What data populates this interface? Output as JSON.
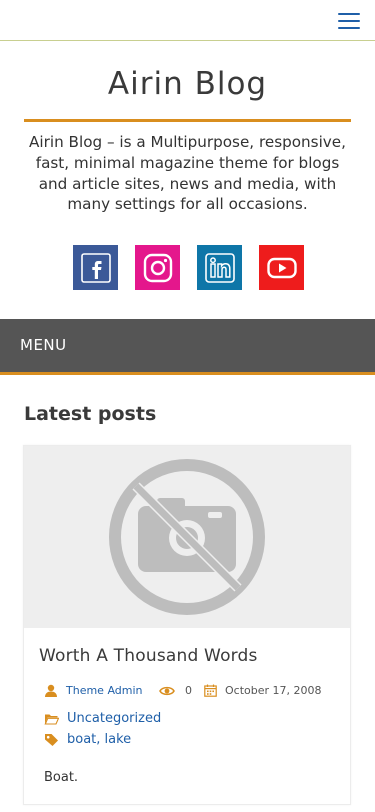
{
  "header": {
    "menu_icon": "hamburger-icon"
  },
  "site": {
    "title": "Airin Blog",
    "tagline": "Airin Blog – is a Multipurpose, responsive, fast, minimal magazine theme for blogs and article sites, news and media, with many settings for all occasions."
  },
  "social": [
    {
      "name": "facebook",
      "icon": "facebook-icon",
      "color": "#3b5998"
    },
    {
      "name": "instagram",
      "icon": "instagram-icon",
      "color": "#e4178c"
    },
    {
      "name": "linkedin",
      "icon": "linkedin-icon",
      "color": "#0e76a8"
    },
    {
      "name": "youtube",
      "icon": "youtube-icon",
      "color": "#ee1c1c"
    }
  ],
  "nav": {
    "menu_label": "MENU"
  },
  "main": {
    "section_title": "Latest posts",
    "posts": [
      {
        "title": "Worth A Thousand Words",
        "author": "Theme Admin",
        "views": "0",
        "date": "October 17, 2008",
        "category": "Uncategorized",
        "tags": "boat, lake",
        "excerpt": "Boat."
      }
    ]
  },
  "colors": {
    "accent": "#d98e1f",
    "link": "#1f5fa8",
    "menubar": "#555555"
  }
}
